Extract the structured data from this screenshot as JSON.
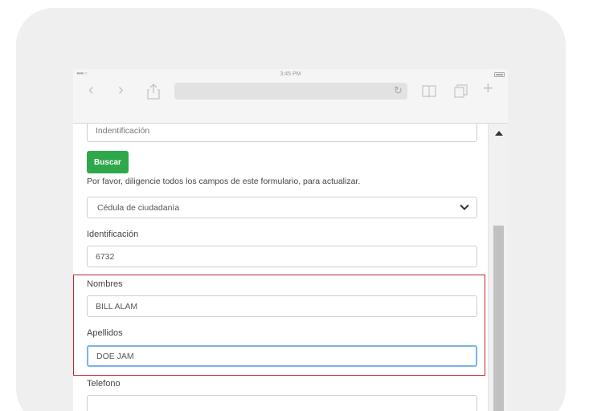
{
  "status_bar": {
    "time": "3:45 PM",
    "signal": "●●●○○"
  },
  "browser": {
    "back_icon": "chevron-left-icon",
    "forward_icon": "chevron-right-icon",
    "share_icon": "share-icon",
    "reload_icon": "reload-icon",
    "bookmarks_icon": "book-icon",
    "tabs_icon": "tabs-icon",
    "new_tab_icon": "plus-icon"
  },
  "form": {
    "top_identification_placeholder": "Indentificación",
    "search_button_label": "Buscar",
    "instructions": "Por favor, diligencie todos los campos de este formulario, para actualizar.",
    "document_type_value": "Cédula de ciudadanía",
    "identification_label": "Identificación",
    "identification_value": "6732",
    "first_names_label": "Nombres",
    "first_names_value": "BILL ALAM",
    "last_names_label": "Apellidos",
    "last_names_value": "DOE JAM",
    "phone_label": "Telefono"
  },
  "colors": {
    "primary_button": "#2ea84a",
    "highlight": "#c0272d",
    "focus_border": "#79b4e8"
  }
}
